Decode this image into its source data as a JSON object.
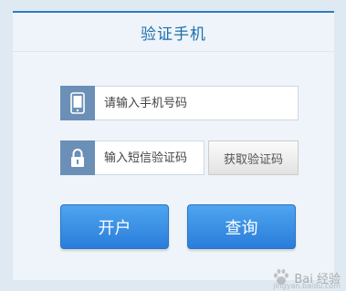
{
  "header": {
    "title": "验证手机"
  },
  "form": {
    "phone": {
      "placeholder": "请输入手机号码",
      "icon": "mobile-phone-icon"
    },
    "sms": {
      "placeholder": "输入短信验证码",
      "icon": "lock-icon"
    },
    "get_code_label": "获取验证码"
  },
  "actions": {
    "open_label": "开户",
    "query_label": "查询"
  },
  "watermark": {
    "text": "Bai 经验",
    "sub": "jingyan.baidu.com"
  },
  "colors": {
    "accent": "#2d7dc0",
    "icon_box": "#6b8fb7",
    "button": "#3a90e6"
  }
}
